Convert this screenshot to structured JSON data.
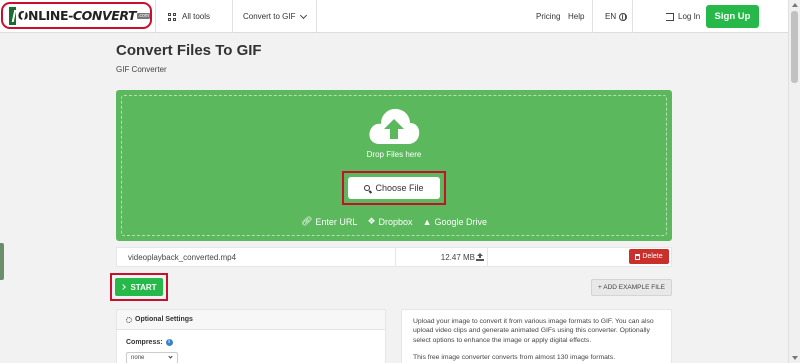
{
  "brand": {
    "logo_text_a": "ONLINE-",
    "logo_text_b": "CONVERT",
    "logo_suffix": ".com"
  },
  "nav": {
    "all_tools": "All tools",
    "convert_to": "Convert to GIF",
    "pricing": "Pricing",
    "help": "Help",
    "language": "EN",
    "login": "Log In",
    "signup": "Sign Up"
  },
  "page": {
    "title": "Convert Files To GIF",
    "subtitle": "GIF Converter"
  },
  "dropzone": {
    "drop_text": "Drop Files here",
    "choose_file": "Choose File",
    "sources": [
      "Enter URL",
      "Dropbox",
      "Google Drive"
    ]
  },
  "file": {
    "name": "videoplayback_converted.mp4",
    "size": "12.47 MB",
    "delete_label": "Delete"
  },
  "actions": {
    "start": "START",
    "add_example": "+ ADD EXAMPLE FILE"
  },
  "settings": {
    "header": "Optional Settings",
    "compress_label": "Compress:",
    "compress_value": "none"
  },
  "description": {
    "p1": "Upload your image to convert it from various image formats to GIF. You can also upload video clips and generate animated GIFs using this converter. Optionally select options to enhance the image or apply digital effects.",
    "p2": "This free image converter converts from almost 130 image formats."
  },
  "colors": {
    "green": "#5cb85c",
    "cta": "#27b84a",
    "danger": "#c9302c",
    "highlight": "#c8102e"
  },
  "icons": [
    "grid-icon",
    "chevron-down-icon",
    "globe-icon",
    "login-icon",
    "cloud-upload-icon",
    "search-icon",
    "link-icon",
    "dropbox-icon",
    "google-drive-icon",
    "upload-icon",
    "trash-icon",
    "arrow-right-icon",
    "gear-icon",
    "info-icon"
  ]
}
